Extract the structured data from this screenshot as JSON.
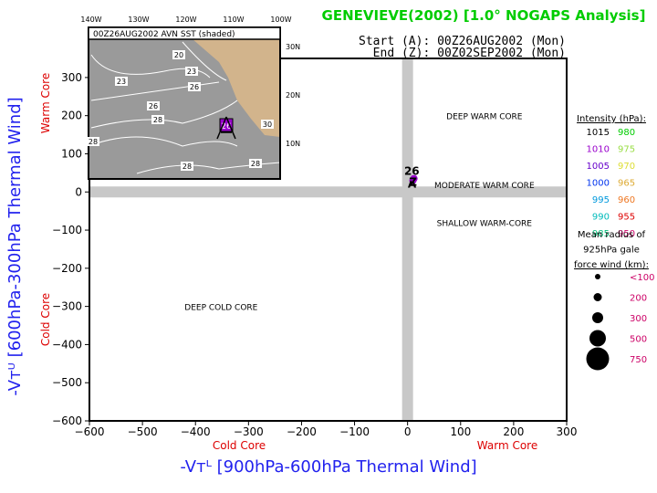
{
  "title": "GENEVIEVE(2002) [1.0° NOGAPS Analysis]",
  "start_label": "Start (A): 00Z26AUG2002 (Mon)",
  "end_label": "End (Z): 00Z02SEP2002 (Mon)",
  "colors": {
    "title": "#00cc00",
    "axis_title": "#2222ee",
    "core_label": "#dd0000",
    "band": "#c8c8c8",
    "land": "#d2b48c",
    "sea": "#9a9a9a",
    "marker": "#9900cc"
  },
  "chart_data": {
    "type": "scatter",
    "title": "GENEVIEVE(2002) [1.0° NOGAPS Analysis]",
    "xlabel": "-Vt^L [900hPa-600hPa Thermal Wind]",
    "ylabel": "-Vt^U [600hPa-300hPa Thermal Wind]",
    "xlim": [
      -600,
      300
    ],
    "ylim": [
      -600,
      350
    ],
    "xticks": [
      -600,
      -500,
      -400,
      -300,
      -200,
      -100,
      0,
      100,
      200,
      300
    ],
    "yticks": [
      -600,
      -500,
      -400,
      -300,
      -200,
      -100,
      0,
      100,
      200,
      300
    ],
    "x_side_labels": {
      "negative": "Cold Core",
      "positive": "Warm Core"
    },
    "y_side_labels": {
      "negative": "Cold Core",
      "positive": "Warm Core"
    },
    "quadrant_labels": [
      {
        "text": "DEEP WARM CORE",
        "x": 150,
        "y": 200
      },
      {
        "text": "MODERATE WARM CORE",
        "x": 150,
        "y": 20
      },
      {
        "text": "SHALLOW WARM-CORE",
        "x": 150,
        "y": -80
      },
      {
        "text": "DEEP COLD CORE",
        "x": -300,
        "y": -300
      }
    ],
    "points": [
      {
        "label": "A",
        "x": 10,
        "y": 30,
        "date": "00Z26AUG2002"
      },
      {
        "label": "Z",
        "x": 12,
        "y": 35,
        "date": "00Z02SEP2002"
      }
    ],
    "legend": {
      "placement": "right",
      "intensity_title": "Intensity (hPa):",
      "intensity": [
        {
          "a": "1015",
          "ca": "#000000",
          "b": "980",
          "cb": "#00cc00"
        },
        {
          "a": "1010",
          "ca": "#9900cc",
          "b": "975",
          "cb": "#99dd44"
        },
        {
          "a": "1005",
          "ca": "#6600cc",
          "b": "970",
          "cb": "#dddd33"
        },
        {
          "a": "1000",
          "ca": "#0033ee",
          "b": "965",
          "cb": "#ddaa33"
        },
        {
          "a": "995",
          "ca": "#0099dd",
          "b": "960",
          "cb": "#ee7722"
        },
        {
          "a": "990",
          "ca": "#00bbbb",
          "b": "955",
          "cb": "#dd0000"
        },
        {
          "a": "985",
          "ca": "#00bb77",
          "b": "950",
          "cb": "#cc0066"
        }
      ],
      "radius_title": [
        "Mean radius of",
        "925hPa gale",
        "force wind (km):"
      ],
      "radius": [
        "<100",
        "200",
        "300",
        "500",
        "750"
      ],
      "radius_color": "#cc0066"
    },
    "inset": {
      "title": "00Z26AUG2002 AVN SST (shaded)",
      "lon_ticks": [
        "140W",
        "130W",
        "120W",
        "110W",
        "100W"
      ],
      "lat_ticks": [
        "30N",
        "20N",
        "10N"
      ],
      "contour_labels": [
        "20",
        "23",
        "23",
        "26",
        "26",
        "28",
        "28",
        "28",
        "28",
        "30"
      ],
      "storm_marker_label": "26"
    }
  }
}
